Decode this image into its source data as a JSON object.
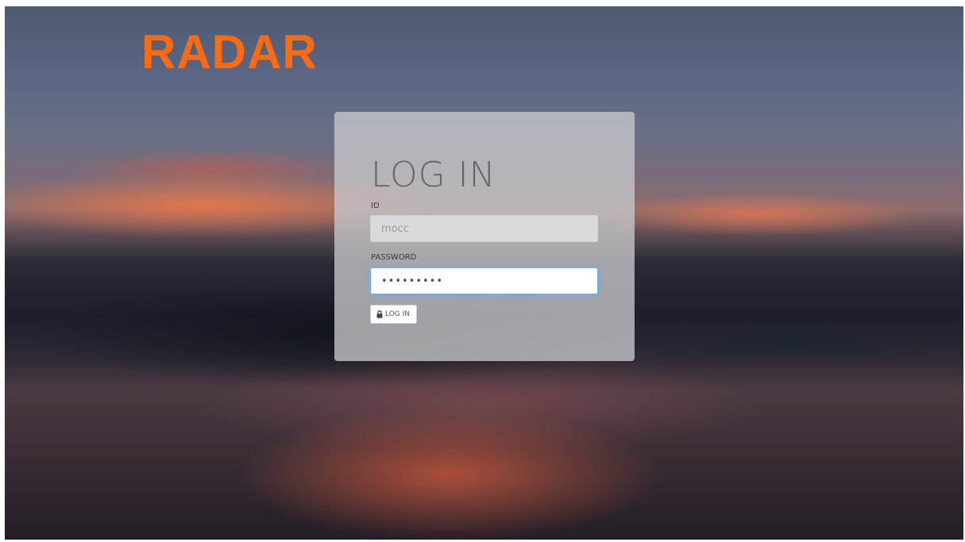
{
  "brand": {
    "logo_text": "RADAR",
    "color": "#ff6a13"
  },
  "login": {
    "title": "LOG IN",
    "id_label": "ID",
    "id_value": "mocc",
    "password_label": "PASSWORD",
    "password_value": "•••••••••",
    "button_label": "LOG IN",
    "button_icon": "lock-icon",
    "focus_color": "#66afe9"
  }
}
